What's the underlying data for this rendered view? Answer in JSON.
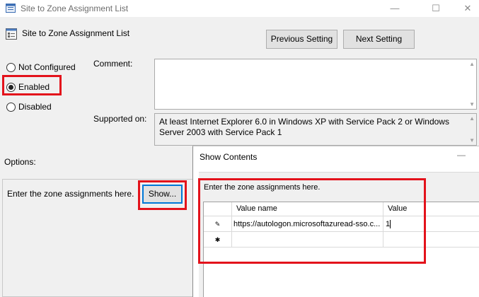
{
  "window": {
    "title": "Site to Zone Assignment List",
    "minimize": "—",
    "maximize": "☐",
    "close": "✕"
  },
  "policy": {
    "title": "Site to Zone Assignment List",
    "previous_setting": "Previous Setting",
    "next_setting": "Next Setting"
  },
  "state": {
    "not_configured": "Not Configured",
    "enabled": "Enabled",
    "disabled": "Disabled",
    "selected": "enabled"
  },
  "comment": {
    "label": "Comment:",
    "value": ""
  },
  "supported": {
    "label": "Supported on:",
    "value": "At least Internet Explorer 6.0 in Windows XP with Service Pack 2 or Windows Server 2003 with Service Pack 1"
  },
  "options": {
    "label": "Options:",
    "prompt": "Enter the zone assignments here.",
    "show_button": "Show..."
  },
  "show_contents": {
    "title": "Show Contents",
    "minimize": "—",
    "prompt": "Enter the zone assignments here.",
    "columns": [
      "Value name",
      "Value"
    ],
    "rows": [
      {
        "marker": "✎",
        "name": "https://autologon.microsoftazuread-sso.c...",
        "value": "1"
      },
      {
        "marker": "✱",
        "name": "",
        "value": ""
      }
    ]
  },
  "colors": {
    "highlight": "#e3121b",
    "window_bg": "#f0f0f0"
  }
}
